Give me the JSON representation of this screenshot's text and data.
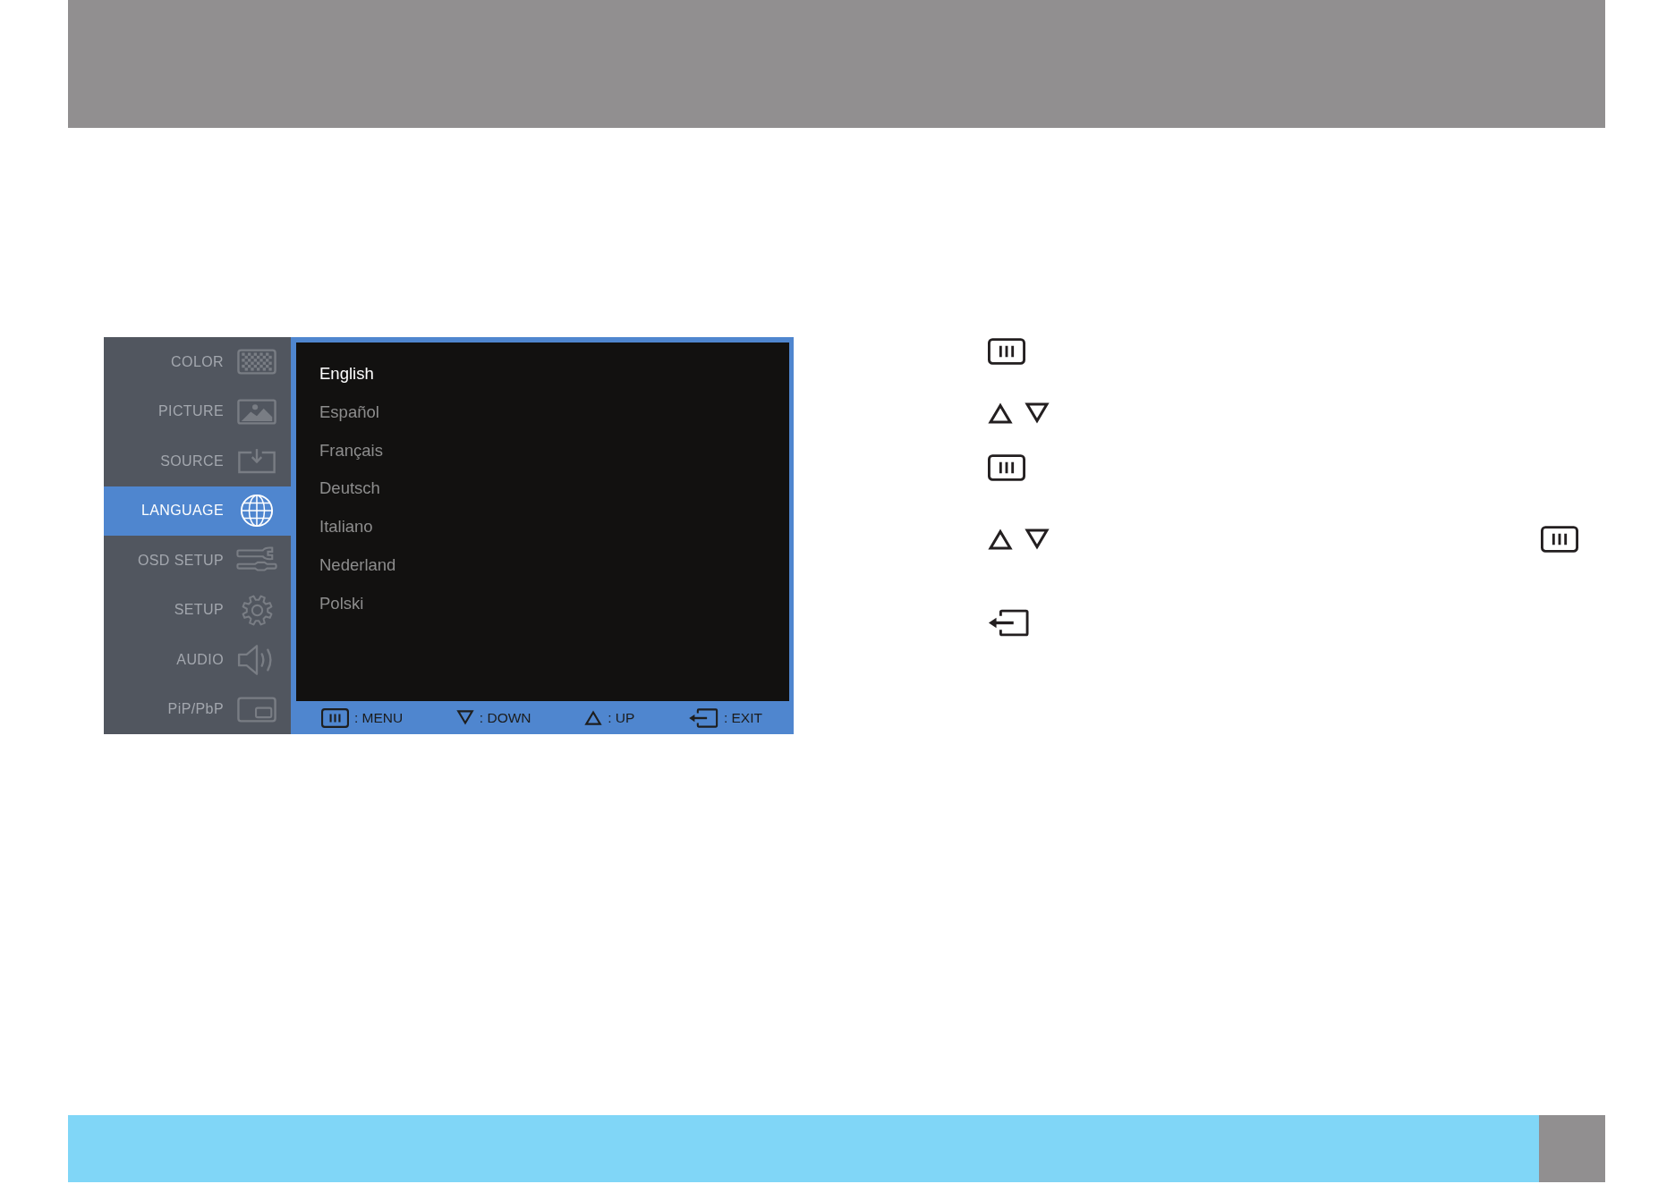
{
  "osd_menu": {
    "sidebar": {
      "items": [
        {
          "label": "COLOR",
          "kind": "checker",
          "selected": false
        },
        {
          "label": "PICTURE",
          "kind": "landscape",
          "selected": false
        },
        {
          "label": "SOURCE",
          "kind": "input",
          "selected": false
        },
        {
          "label": "LANGUAGE",
          "kind": "globe",
          "selected": true
        },
        {
          "label": "OSD SETUP",
          "kind": "tools",
          "selected": false
        },
        {
          "label": "SETUP",
          "kind": "gear",
          "selected": false
        },
        {
          "label": "AUDIO",
          "kind": "speaker",
          "selected": false
        },
        {
          "label": "PiP/PbP",
          "kind": "pip",
          "selected": false
        }
      ]
    },
    "languages": [
      {
        "label": "English",
        "selected": true
      },
      {
        "label": "Español",
        "selected": false
      },
      {
        "label": "Français",
        "selected": false
      },
      {
        "label": "Deutsch",
        "selected": false
      },
      {
        "label": "Italiano",
        "selected": false
      },
      {
        "label": "Nederland",
        "selected": false
      },
      {
        "label": "Polski",
        "selected": false
      }
    ],
    "key_hints": [
      {
        "kind": "menu",
        "label": ": MENU"
      },
      {
        "kind": "down",
        "label": ": DOWN"
      },
      {
        "kind": "up",
        "label": ": UP"
      },
      {
        "kind": "exit",
        "label": ": EXIT"
      }
    ]
  },
  "key_guide": [
    {
      "icons": [
        {
          "kind": "menu"
        }
      ]
    },
    {
      "icons": [
        {
          "kind": "up"
        },
        {
          "kind": "down"
        }
      ]
    },
    {
      "icons": [
        {
          "kind": "menu"
        }
      ]
    },
    {
      "icons": [
        {
          "kind": "up"
        },
        {
          "kind": "down"
        }
      ],
      "end_icons": [
        {
          "kind": "menu"
        }
      ]
    },
    {
      "icons": [
        {
          "kind": "exit"
        }
      ]
    }
  ]
}
